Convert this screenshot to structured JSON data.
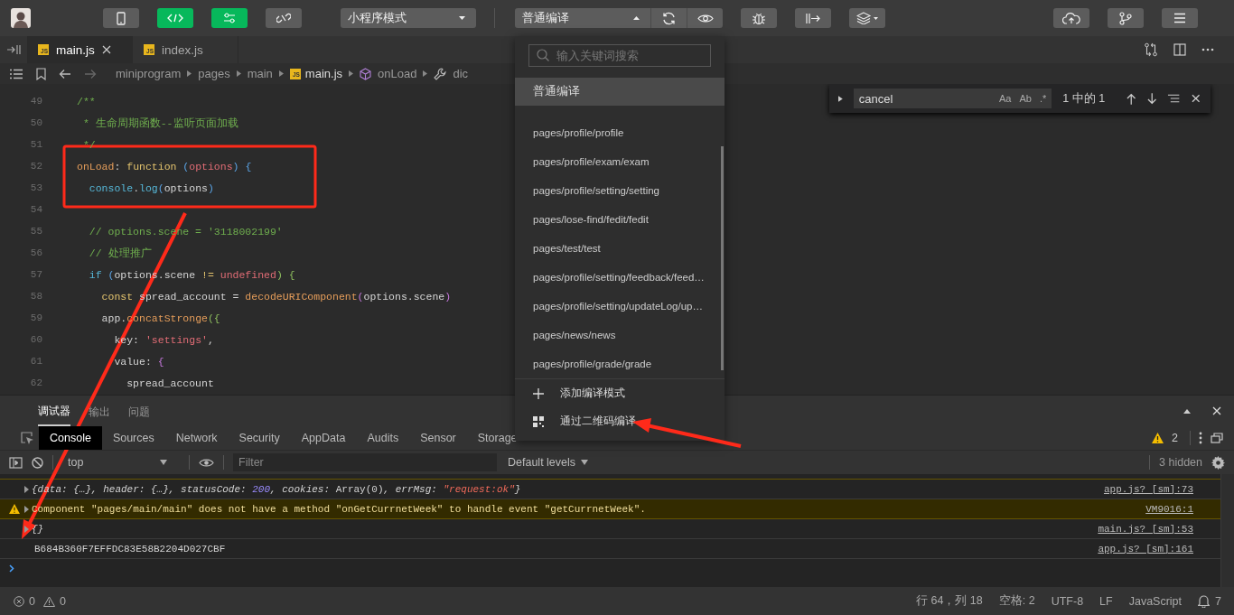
{
  "toolbar": {
    "view_buttons": [
      {
        "kind": "simulator",
        "selected": false
      },
      {
        "kind": "editor",
        "selected": true
      },
      {
        "kind": "debugger",
        "selected": true
      },
      {
        "kind": "visual",
        "selected": false
      }
    ],
    "mode_select": {
      "value": "小程序模式"
    },
    "compile_select": {
      "value": "普通编译",
      "expanded": true
    }
  },
  "editor_tabs": [
    {
      "label": "main.js",
      "badge": "JS",
      "selected": true
    },
    {
      "label": "index.js",
      "badge": "JS",
      "selected": false
    }
  ],
  "breadcrumb": [
    {
      "label": "miniprogram",
      "kind": "folder"
    },
    {
      "label": "pages",
      "kind": "folder"
    },
    {
      "label": "main",
      "kind": "folder"
    },
    {
      "label": "main.js",
      "kind": "file",
      "badge": "JS"
    },
    {
      "label": "onLoad",
      "kind": "method"
    },
    {
      "label": "dic",
      "kind": "property"
    }
  ],
  "editor": {
    "lines": [
      {
        "number": "49",
        "tokens": [
          {
            "text": "/**",
            "kind": "comment"
          }
        ]
      },
      {
        "number": "50",
        "tokens": [
          {
            "text": " * 生命周期函数--监听页面加载",
            "kind": "comment"
          }
        ]
      },
      {
        "number": "51",
        "tokens": [
          {
            "text": " */",
            "kind": "comment"
          }
        ]
      },
      {
        "number": "52",
        "tokens": [
          {
            "text": "onLoad",
            "kind": "key"
          },
          {
            "text": ": ",
            "kind": "plain"
          },
          {
            "text": "function",
            "kind": "keyword"
          },
          {
            "text": " (",
            "kind": "punct"
          },
          {
            "text": "options",
            "kind": "param"
          },
          {
            "text": ") {",
            "kind": "punct"
          }
        ]
      },
      {
        "number": "53",
        "tokens": [
          {
            "text": "  console",
            "kind": "builtin"
          },
          {
            "text": ".",
            "kind": "plain"
          },
          {
            "text": "log",
            "kind": "builtin"
          },
          {
            "text": "(",
            "kind": "punct"
          },
          {
            "text": "options",
            "kind": "plain"
          },
          {
            "text": ")",
            "kind": "punct"
          }
        ]
      },
      {
        "number": "54"
      },
      {
        "number": "55",
        "tokens": [
          {
            "text": "  // options.scene = '3118002199'",
            "kind": "comment"
          }
        ]
      },
      {
        "number": "56",
        "tokens": [
          {
            "text": "  // 处理推广",
            "kind": "comment"
          }
        ]
      },
      {
        "number": "57",
        "tokens": [
          {
            "text": "  if",
            "kind": "builtin"
          },
          {
            "text": " (",
            "kind": "punct"
          },
          {
            "text": "options.scene ",
            "kind": "plain"
          },
          {
            "text": "!=",
            "kind": "keyword"
          },
          {
            "text": " undefined",
            "kind": "param"
          },
          {
            "text": ") {",
            "kind": "brace"
          }
        ]
      },
      {
        "number": "58",
        "tokens": [
          {
            "text": "    const",
            "kind": "keyword"
          },
          {
            "text": " spread_account = ",
            "kind": "plain"
          },
          {
            "text": "decodeURIComponent",
            "kind": "key"
          },
          {
            "text": "(",
            "kind": "brace2"
          },
          {
            "text": "options.scene",
            "kind": "plain"
          },
          {
            "text": ")",
            "kind": "brace2"
          }
        ]
      },
      {
        "number": "59",
        "tokens": [
          {
            "text": "    app.",
            "kind": "plain"
          },
          {
            "text": "concatStronge",
            "kind": "key"
          },
          {
            "text": "({",
            "kind": "brace"
          }
        ]
      },
      {
        "number": "60",
        "tokens": [
          {
            "text": "      key: ",
            "kind": "plain"
          },
          {
            "text": "'settings'",
            "kind": "string"
          },
          {
            "text": ",",
            "kind": "plain"
          }
        ]
      },
      {
        "number": "61",
        "tokens": [
          {
            "text": "      value: ",
            "kind": "plain"
          },
          {
            "text": "{",
            "kind": "brace2"
          }
        ]
      },
      {
        "number": "62",
        "tokens": [
          {
            "text": "        spread_account",
            "kind": "plain"
          }
        ]
      }
    ]
  },
  "find_widget": {
    "value": "cancel",
    "options": [
      "Aa",
      "Ab",
      ".*"
    ],
    "result": "1 中的 1"
  },
  "compile_menu": {
    "placeholder": "输入关键词搜索",
    "current": {
      "label": "普通编译",
      "selected": true
    },
    "items": [
      {
        "label": "pages/profile/profile",
        "selected": false
      },
      {
        "label": "pages/profile/exam/exam",
        "selected": false
      },
      {
        "label": "pages/profile/setting/setting",
        "selected": false
      },
      {
        "label": "pages/lose-find/fedit/fedit",
        "selected": false
      },
      {
        "label": "pages/test/test",
        "selected": false
      },
      {
        "label": "pages/profile/setting/feedback/feed…",
        "selected": false
      },
      {
        "label": "pages/profile/setting/updateLog/up…",
        "selected": false
      },
      {
        "label": "pages/news/news",
        "selected": false
      },
      {
        "label": "pages/profile/grade/grade",
        "selected": false
      }
    ],
    "actions": [
      {
        "label": "添加编译模式",
        "kind": "add"
      },
      {
        "label": "通过二维码编译",
        "kind": "qr"
      }
    ]
  },
  "debug_panel": {
    "tabs": [
      {
        "label": "调试器",
        "selected": true
      },
      {
        "label": "输出",
        "selected": false
      },
      {
        "label": "问题",
        "selected": false
      }
    ],
    "devtools_tabs": [
      {
        "label": "Console",
        "selected": true
      },
      {
        "label": "Sources",
        "selected": false
      },
      {
        "label": "Network",
        "selected": false
      },
      {
        "label": "Security",
        "selected": false
      },
      {
        "label": "AppData",
        "selected": false
      },
      {
        "label": "Audits",
        "selected": false
      },
      {
        "label": "Sensor",
        "selected": false
      },
      {
        "label": "Storage",
        "selected": false
      }
    ],
    "warning_count": "2",
    "context": "top",
    "filter_placeholder": "Filter",
    "levels": "Default levels",
    "hidden_count": "3 hidden",
    "messages": [
      {
        "kind": "log",
        "expandable": true,
        "tokens": [
          {
            "text": "{data: {…}, header: {…}, statusCode: ",
            "kind": "obj"
          },
          {
            "text": "200",
            "kind": "number"
          },
          {
            "text": ", cookies: ",
            "kind": "obj"
          },
          {
            "text": "Array(0)",
            "kind": "plain"
          },
          {
            "text": ", errMsg: ",
            "kind": "obj"
          },
          {
            "text": "\"request:ok\"",
            "kind": "string"
          },
          {
            "text": "}",
            "kind": "obj"
          }
        ],
        "source": "app.js? [sm]:73"
      },
      {
        "kind": "warning",
        "expandable": true,
        "tokens": [
          {
            "text": "Component \"pages/main/main\" does not have a method \"onGetCurrnetWeek\" to handle event \"getCurrnetWeek\".",
            "kind": "plain"
          }
        ],
        "source": "VM9016:1"
      },
      {
        "kind": "log",
        "expandable": true,
        "tokens": [
          {
            "text": "{}",
            "kind": "obj"
          }
        ],
        "source": "main.js? [sm]:53"
      },
      {
        "kind": "log",
        "expandable": false,
        "tokens": [
          {
            "text": "B684B360F7EFFDC83E58B2204D027CBF",
            "kind": "plain"
          }
        ],
        "source": "app.js? [sm]:161"
      }
    ]
  },
  "status_bar": {
    "errors": "0",
    "warnings": "0",
    "position": "行 64，列 18",
    "indent": "空格: 2",
    "encoding": "UTF-8",
    "eol": "LF",
    "language": "JavaScript",
    "notifications": "7"
  }
}
